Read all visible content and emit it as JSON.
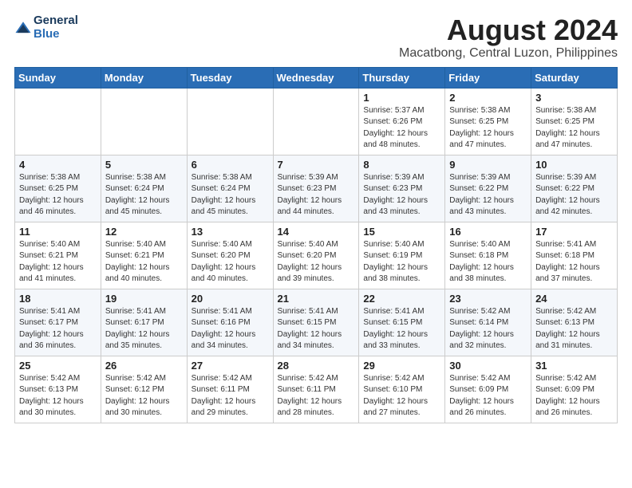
{
  "header": {
    "logo_general": "General",
    "logo_blue": "Blue",
    "title": "August 2024",
    "subtitle": "Macatbong, Central Luzon, Philippines"
  },
  "days_of_week": [
    "Sunday",
    "Monday",
    "Tuesday",
    "Wednesday",
    "Thursday",
    "Friday",
    "Saturday"
  ],
  "weeks": [
    [
      {
        "day": "",
        "info": ""
      },
      {
        "day": "",
        "info": ""
      },
      {
        "day": "",
        "info": ""
      },
      {
        "day": "",
        "info": ""
      },
      {
        "day": "1",
        "info": "Sunrise: 5:37 AM\nSunset: 6:26 PM\nDaylight: 12 hours\nand 48 minutes."
      },
      {
        "day": "2",
        "info": "Sunrise: 5:38 AM\nSunset: 6:25 PM\nDaylight: 12 hours\nand 47 minutes."
      },
      {
        "day": "3",
        "info": "Sunrise: 5:38 AM\nSunset: 6:25 PM\nDaylight: 12 hours\nand 47 minutes."
      }
    ],
    [
      {
        "day": "4",
        "info": "Sunrise: 5:38 AM\nSunset: 6:25 PM\nDaylight: 12 hours\nand 46 minutes."
      },
      {
        "day": "5",
        "info": "Sunrise: 5:38 AM\nSunset: 6:24 PM\nDaylight: 12 hours\nand 45 minutes."
      },
      {
        "day": "6",
        "info": "Sunrise: 5:38 AM\nSunset: 6:24 PM\nDaylight: 12 hours\nand 45 minutes."
      },
      {
        "day": "7",
        "info": "Sunrise: 5:39 AM\nSunset: 6:23 PM\nDaylight: 12 hours\nand 44 minutes."
      },
      {
        "day": "8",
        "info": "Sunrise: 5:39 AM\nSunset: 6:23 PM\nDaylight: 12 hours\nand 43 minutes."
      },
      {
        "day": "9",
        "info": "Sunrise: 5:39 AM\nSunset: 6:22 PM\nDaylight: 12 hours\nand 43 minutes."
      },
      {
        "day": "10",
        "info": "Sunrise: 5:39 AM\nSunset: 6:22 PM\nDaylight: 12 hours\nand 42 minutes."
      }
    ],
    [
      {
        "day": "11",
        "info": "Sunrise: 5:40 AM\nSunset: 6:21 PM\nDaylight: 12 hours\nand 41 minutes."
      },
      {
        "day": "12",
        "info": "Sunrise: 5:40 AM\nSunset: 6:21 PM\nDaylight: 12 hours\nand 40 minutes."
      },
      {
        "day": "13",
        "info": "Sunrise: 5:40 AM\nSunset: 6:20 PM\nDaylight: 12 hours\nand 40 minutes."
      },
      {
        "day": "14",
        "info": "Sunrise: 5:40 AM\nSunset: 6:20 PM\nDaylight: 12 hours\nand 39 minutes."
      },
      {
        "day": "15",
        "info": "Sunrise: 5:40 AM\nSunset: 6:19 PM\nDaylight: 12 hours\nand 38 minutes."
      },
      {
        "day": "16",
        "info": "Sunrise: 5:40 AM\nSunset: 6:18 PM\nDaylight: 12 hours\nand 38 minutes."
      },
      {
        "day": "17",
        "info": "Sunrise: 5:41 AM\nSunset: 6:18 PM\nDaylight: 12 hours\nand 37 minutes."
      }
    ],
    [
      {
        "day": "18",
        "info": "Sunrise: 5:41 AM\nSunset: 6:17 PM\nDaylight: 12 hours\nand 36 minutes."
      },
      {
        "day": "19",
        "info": "Sunrise: 5:41 AM\nSunset: 6:17 PM\nDaylight: 12 hours\nand 35 minutes."
      },
      {
        "day": "20",
        "info": "Sunrise: 5:41 AM\nSunset: 6:16 PM\nDaylight: 12 hours\nand 34 minutes."
      },
      {
        "day": "21",
        "info": "Sunrise: 5:41 AM\nSunset: 6:15 PM\nDaylight: 12 hours\nand 34 minutes."
      },
      {
        "day": "22",
        "info": "Sunrise: 5:41 AM\nSunset: 6:15 PM\nDaylight: 12 hours\nand 33 minutes."
      },
      {
        "day": "23",
        "info": "Sunrise: 5:42 AM\nSunset: 6:14 PM\nDaylight: 12 hours\nand 32 minutes."
      },
      {
        "day": "24",
        "info": "Sunrise: 5:42 AM\nSunset: 6:13 PM\nDaylight: 12 hours\nand 31 minutes."
      }
    ],
    [
      {
        "day": "25",
        "info": "Sunrise: 5:42 AM\nSunset: 6:13 PM\nDaylight: 12 hours\nand 30 minutes."
      },
      {
        "day": "26",
        "info": "Sunrise: 5:42 AM\nSunset: 6:12 PM\nDaylight: 12 hours\nand 30 minutes."
      },
      {
        "day": "27",
        "info": "Sunrise: 5:42 AM\nSunset: 6:11 PM\nDaylight: 12 hours\nand 29 minutes."
      },
      {
        "day": "28",
        "info": "Sunrise: 5:42 AM\nSunset: 6:11 PM\nDaylight: 12 hours\nand 28 minutes."
      },
      {
        "day": "29",
        "info": "Sunrise: 5:42 AM\nSunset: 6:10 PM\nDaylight: 12 hours\nand 27 minutes."
      },
      {
        "day": "30",
        "info": "Sunrise: 5:42 AM\nSunset: 6:09 PM\nDaylight: 12 hours\nand 26 minutes."
      },
      {
        "day": "31",
        "info": "Sunrise: 5:42 AM\nSunset: 6:09 PM\nDaylight: 12 hours\nand 26 minutes."
      }
    ]
  ]
}
